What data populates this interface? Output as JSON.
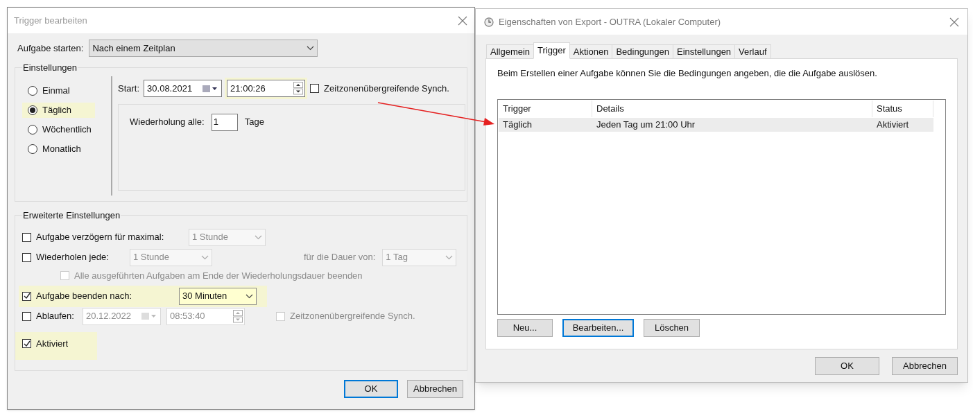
{
  "edit_dialog": {
    "title": "Trigger bearbeiten",
    "start_task": {
      "label": "Aufgabe starten:",
      "value": "Nach einem Zeitplan"
    },
    "settings": {
      "title": "Einstellungen",
      "schedule_options": [
        {
          "label": "Einmal",
          "selected": false,
          "highlighted": false
        },
        {
          "label": "Täglich",
          "selected": true,
          "highlighted": true
        },
        {
          "label": "Wöchentlich",
          "selected": false,
          "highlighted": false
        },
        {
          "label": "Monatlich",
          "selected": false,
          "highlighted": false
        }
      ],
      "start": {
        "label": "Start:",
        "date": "30.08.2021",
        "time": "21:00:26",
        "time_highlighted": true
      },
      "sync": {
        "label": "Zeitzonenübergreifende Synch.",
        "checked": false
      },
      "repeat": {
        "label": "Wiederholung alle:",
        "value": "1",
        "unit": "Tage"
      }
    },
    "advanced": {
      "title": "Erweiterte Einstellungen",
      "delay": {
        "label": "Aufgabe verzögern für maximal:",
        "checked": false,
        "value": "1 Stunde"
      },
      "repeat": {
        "label": "Wiederholen jede:",
        "checked": false,
        "value": "1 Stunde",
        "duration_label": "für die Dauer von:",
        "duration_value": "1 Tag"
      },
      "stop_all": {
        "label": "Alle ausgeführten Aufgaben am Ende der Wiederholungsdauer beenden",
        "checked": false,
        "disabled": true
      },
      "stop_after": {
        "label": "Aufgabe beenden nach:",
        "checked": true,
        "value": "30 Minuten",
        "highlighted": true
      },
      "expire": {
        "label": "Ablaufen:",
        "checked": false,
        "date": "20.12.2022",
        "time": "08:53:40",
        "sync_label": "Zeitzonenübergreifende Synch.",
        "sync_checked": false
      },
      "enabled": {
        "label": "Aktiviert",
        "checked": true,
        "highlighted": true
      }
    },
    "buttons": [
      {
        "label": "OK",
        "focused": true
      },
      {
        "label": "Abbrechen",
        "focused": false
      }
    ]
  },
  "properties_dialog": {
    "title": "Eigenschaften von Export - OUTRA (Lokaler Computer)",
    "tabs": [
      {
        "label": "Allgemein",
        "selected": false
      },
      {
        "label": "Trigger",
        "selected": true
      },
      {
        "label": "Aktionen",
        "selected": false
      },
      {
        "label": "Bedingungen",
        "selected": false
      },
      {
        "label": "Einstellungen",
        "selected": false
      },
      {
        "label": "Verlauf",
        "selected": false
      }
    ],
    "description": "Beim Erstellen einer Aufgabe können Sie die Bedingungen angeben, die die Aufgabe auslösen.",
    "table": {
      "columns": [
        "Trigger",
        "Details",
        "Status"
      ],
      "rows": [
        {
          "cells": [
            "Täglich",
            "Jeden Tag um 21:00 Uhr",
            "Aktiviert"
          ],
          "selected": true
        }
      ]
    },
    "action_buttons": [
      {
        "label": "Neu...",
        "focused": false
      },
      {
        "label": "Bearbeiten...",
        "focused": true
      },
      {
        "label": "Löschen",
        "focused": false
      }
    ],
    "buttons": [
      {
        "label": "OK",
        "focused": false
      },
      {
        "label": "Abbrechen",
        "focused": false
      }
    ]
  }
}
